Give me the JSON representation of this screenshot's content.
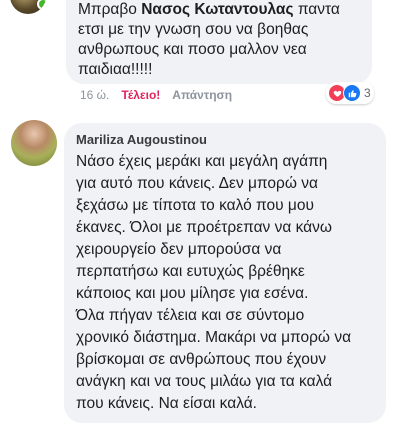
{
  "comment_top": {
    "lines": [
      {
        "prefix": "Μπραβο ",
        "bold": "Νασος Κωταντουλας",
        "suffix": " παντα"
      },
      {
        "text": "ετσι με την γνωση σου να βοηθας"
      },
      {
        "text": "ανθρωπους και ποσο μαλλον νεα"
      },
      {
        "text": "παιδιαα!!!!!"
      }
    ],
    "time": "16 ώ.",
    "like_label": "Τέλειο!",
    "reply_label": "Απάντηση",
    "reaction_count": "3",
    "reaction_icons": [
      "heart-icon",
      "thumbs-up-icon"
    ]
  },
  "comment_main": {
    "author": "Mariliza Augoustinou",
    "lines": [
      "Νάσο έχεις μεράκι και μεγάλη αγάπη",
      "για αυτό που κάνεις. Δεν μπορώ να",
      "ξεχάσω με τίποτα το καλό που μου",
      "έκανες. Όλοι με προέτρεπαν να κάνω",
      "χειρουργείο δεν μπορούσα να",
      "περπατήσω και ευτυχώς βρέθηκε",
      "κάποιος και μου μίλησε για εσένα.",
      "Όλα πήγαν τέλεια και σε σύντομο",
      "χρονικό διάστημα. Μακάρι να μπορώ να",
      "βρίσκομαι σε ανθρώπους που έχουν",
      "ανάγκη και να τους μιλάω για τα καλά",
      "που κάνεις. Να είσαι καλά."
    ]
  },
  "colors": {
    "bubble": "#f0f2f5",
    "reaction_active": "#e0245e",
    "meta_text": "#8d949e",
    "love": "#f33e58",
    "like": "#1877f2"
  }
}
